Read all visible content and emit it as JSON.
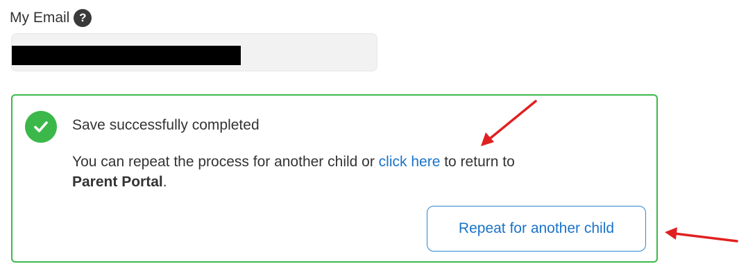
{
  "email_section": {
    "label": "My Email",
    "help_icon": "question-mark-icon",
    "help_glyph": "?",
    "email_value": ""
  },
  "success_panel": {
    "status_icon": "check-circle-icon",
    "title": "Save successfully completed",
    "message_prefix": "You can repeat the process for another child or ",
    "link_text": "click here",
    "message_middle": " to return to ",
    "portal_name": "Parent Portal",
    "message_suffix": ".",
    "repeat_button_label": "Repeat for another child"
  },
  "colors": {
    "success_green": "#3cb84a",
    "link_blue": "#1a73c8",
    "annotation_red": "#e02020"
  }
}
